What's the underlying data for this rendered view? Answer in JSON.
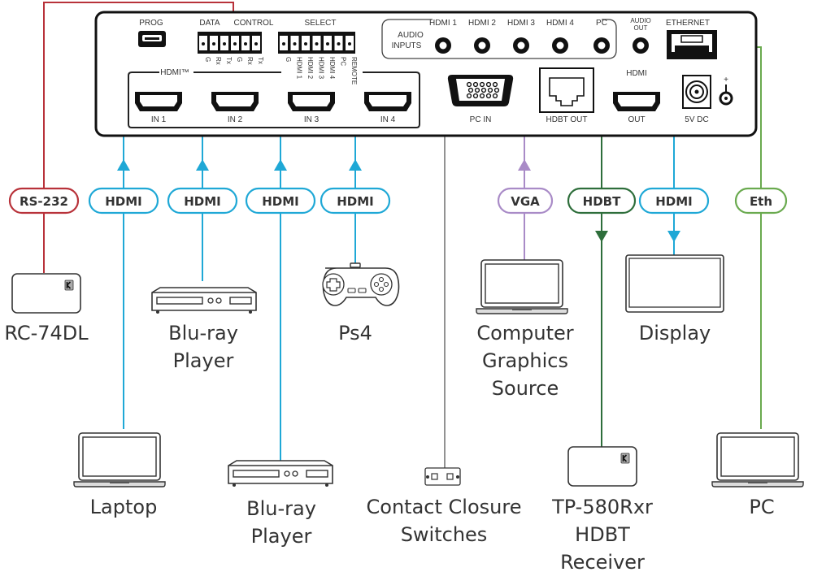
{
  "colors": {
    "rs232": "#b8323a",
    "hdmi": "#1fa8d6",
    "vga": "#a98bc7",
    "hdbt": "#2e6e3b",
    "eth": "#6aaa4f",
    "contact": "#777777",
    "outline": "#333333"
  },
  "panel": {
    "prog_label": "PROG",
    "data_label": "DATA",
    "control_label": "CONTROL",
    "control_pins": [
      "G",
      "Rx",
      "Tx",
      "G",
      "Rx",
      "Tx"
    ],
    "select_label": "SELECT",
    "select_pins": [
      "G",
      "HDMI 1",
      "HDMI 2",
      "HDMI 3",
      "HDMI 4",
      "PC",
      "REMOTE"
    ],
    "audio_inputs_label_1": "AUDIO",
    "audio_inputs_label_2": "INPUTS",
    "audio_inputs": [
      "HDMI 1",
      "HDMI 2",
      "HDMI 3",
      "HDMI 4",
      "PC"
    ],
    "audio_out_label_1": "AUDIO",
    "audio_out_label_2": "OUT",
    "ethernet_label": "ETHERNET",
    "hdmi_group_label": "HDMI™",
    "hdmi_inputs": [
      "IN 1",
      "IN 2",
      "IN 3",
      "IN 4"
    ],
    "pc_in_label": "PC IN",
    "hdbt_out_label": "HDBT OUT",
    "hdmi_out_top_label": "HDMI",
    "hdmi_out_label": "OUT",
    "power_label": "5V DC",
    "plus_sign": "+"
  },
  "connections": [
    {
      "id": "rs232",
      "label": "RS-232"
    },
    {
      "id": "hdmi-in1",
      "label": "HDMI"
    },
    {
      "id": "hdmi-in2",
      "label": "HDMI"
    },
    {
      "id": "hdmi-in3",
      "label": "HDMI"
    },
    {
      "id": "hdmi-in4",
      "label": "HDMI"
    },
    {
      "id": "vga",
      "label": "VGA"
    },
    {
      "id": "hdbt",
      "label": "HDBT"
    },
    {
      "id": "hdmi-out",
      "label": "HDMI"
    },
    {
      "id": "eth",
      "label": "Eth"
    }
  ],
  "devices": {
    "rc74dl": [
      "RC-74DL"
    ],
    "bluray1": [
      "Blu-ray",
      "Player"
    ],
    "ps4": [
      "Ps4"
    ],
    "computer": [
      "Computer",
      "Graphics",
      "Source"
    ],
    "display": [
      "Display"
    ],
    "laptop": [
      "Laptop"
    ],
    "bluray2": [
      "Blu-ray",
      "Player"
    ],
    "contact": [
      "Contact Closure",
      "Switches"
    ],
    "receiver": [
      "TP-580Rxr",
      "HDBT",
      "Receiver"
    ],
    "pc": [
      "PC"
    ]
  }
}
